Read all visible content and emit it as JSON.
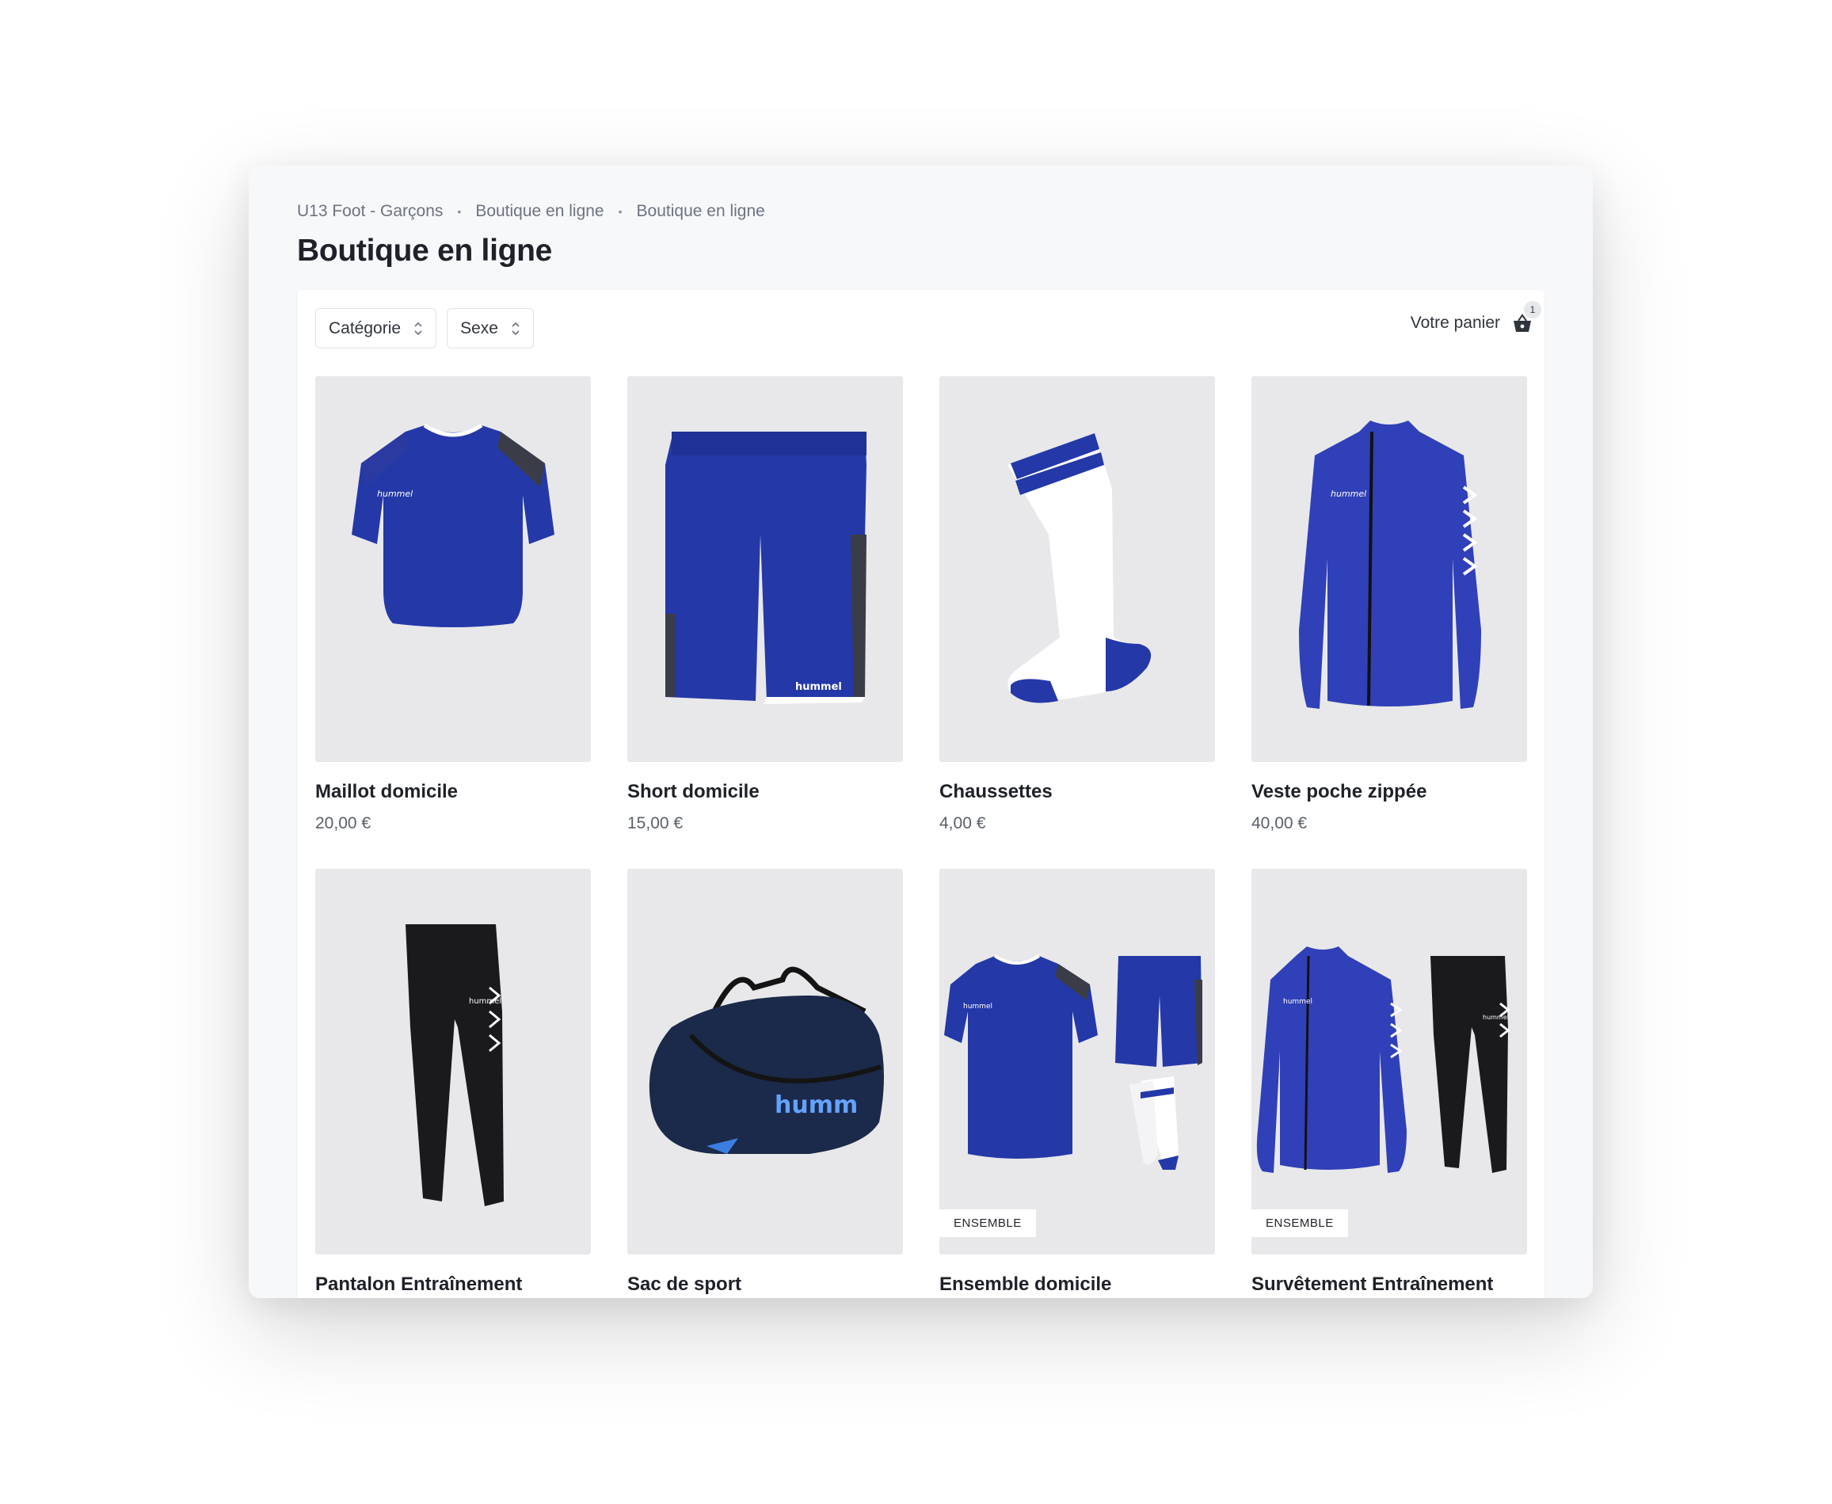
{
  "breadcrumb": [
    "U13 Foot - Garçons",
    "Boutique en ligne",
    "Boutique en ligne"
  ],
  "page_title": "Boutique en ligne",
  "filters": {
    "category": "Catégorie",
    "gender": "Sexe"
  },
  "cart": {
    "label": "Votre panier",
    "count": "1"
  },
  "colors": {
    "accent_blue": "#2438a8",
    "jacket_blue": "#3040b8",
    "navy": "#1b2a4a",
    "image_bg": "#e8e8ea"
  },
  "products": [
    {
      "name": "Maillot domicile",
      "price": "20,00 €",
      "image": "blue-jersey"
    },
    {
      "name": "Short domicile",
      "price": "15,00 €",
      "image": "blue-shorts"
    },
    {
      "name": "Chaussettes",
      "price": "4,00 €",
      "image": "white-socks"
    },
    {
      "name": "Veste poche zippée",
      "price": "40,00 €",
      "image": "blue-jacket"
    },
    {
      "name": "Pantalon Entraînement",
      "price": "",
      "image": "black-pants"
    },
    {
      "name": "Sac de sport",
      "price": "",
      "image": "sports-bag"
    },
    {
      "name": "Ensemble domicile",
      "price": "",
      "image": "home-kit-set",
      "badge": "ENSEMBLE"
    },
    {
      "name": "Survêtement Entraînement",
      "price": "",
      "image": "tracksuit-set",
      "badge": "ENSEMBLE"
    }
  ]
}
